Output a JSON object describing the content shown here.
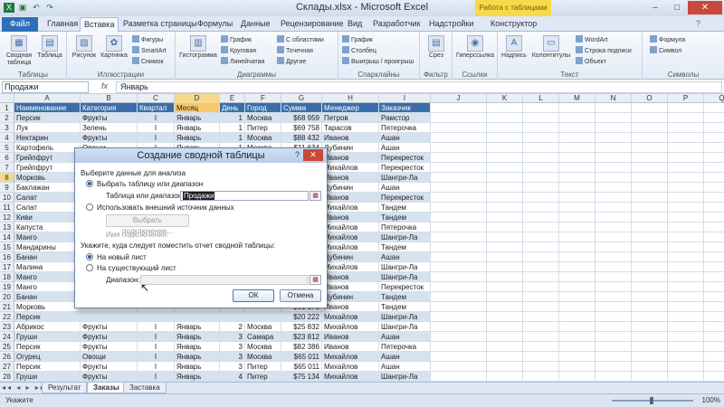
{
  "window": {
    "title": "Склады.xlsx - Microsoft Excel",
    "context_tab_group": "Работа с таблицами",
    "controls": {
      "min": "–",
      "max": "□",
      "close": "✕"
    }
  },
  "ribbon_tabs": [
    "Файл",
    "Главная",
    "Вставка",
    "Разметка страницы",
    "Формулы",
    "Данные",
    "Рецензирование",
    "Вид",
    "Разработчик",
    "Надстройки",
    "Конструктор"
  ],
  "ribbon": {
    "groups": [
      "Таблицы",
      "Иллюстрации",
      "Диаграммы",
      "Спарклайны",
      "Фильтр",
      "Ссылки",
      "Текст",
      "Символы"
    ],
    "buttons": {
      "pivot": "Сводная таблица",
      "table": "Таблица",
      "picture": "Рисунок",
      "clipart": "Картинка",
      "shapes": "Фигуры",
      "smartart": "SmartArt",
      "screenshot": "Снимок",
      "histogram": "Гистограмма",
      "graph": "График",
      "pie": "Круговая",
      "linear": "Линейчатая",
      "area": "С областями",
      "scatter": "Точечная",
      "other": "Другие",
      "spark_line": "График",
      "spark_col": "Столбец",
      "spark_wl": "Выигрыш / проигрыш",
      "slicer": "Срез",
      "hyperlink": "Гиперссылка",
      "textbox": "Надпись",
      "header_footer": "Колонтитулы",
      "wordart": "WordArt",
      "signature": "Строка подписи",
      "object": "Объект",
      "formula": "Формула",
      "symbol": "Символ"
    }
  },
  "formula_bar": {
    "name_box": "Продажи",
    "fx": "fx",
    "value": "Январь"
  },
  "columns": [
    "A",
    "B",
    "C",
    "D",
    "E",
    "F",
    "G",
    "H",
    "I",
    "J",
    "K",
    "L",
    "M",
    "N",
    "O",
    "P",
    "Q"
  ],
  "table_headers": [
    "Наименование",
    "Категория",
    "Квартал",
    "Месяц",
    "День",
    "Город",
    "Сумма",
    "Менеджер",
    "Заказчик"
  ],
  "rows": [
    [
      "Персик",
      "Фрукты",
      "I",
      "Январь",
      "1",
      "Москва",
      "$68 959",
      "Петров",
      "Рамстор"
    ],
    [
      "Лук",
      "Зелень",
      "I",
      "Январь",
      "1",
      "Питер",
      "$69 758",
      "Тарасов",
      "Пятерочка"
    ],
    [
      "Нектарин",
      "Фрукты",
      "I",
      "Январь",
      "1",
      "Москва",
      "$88 432",
      "Иванов",
      "Ашан"
    ],
    [
      "Картофель",
      "Овощи",
      "I",
      "Январь",
      "1",
      "Москва",
      "$11 634",
      "Дубинин",
      "Ашан"
    ],
    [
      "Грейпфрут",
      "",
      "",
      "",
      "",
      "",
      "$18 298",
      "Иванов",
      "Перекресток"
    ],
    [
      "Грейпфрут",
      "",
      "",
      "",
      "",
      "",
      "$ 6 256",
      "Михайлов",
      "Перекресток"
    ],
    [
      "Морковь",
      "",
      "",
      "",
      "",
      "",
      "$ 6 634",
      "Иванов",
      "Шангри-Ла"
    ],
    [
      "Баклажан",
      "",
      "",
      "",
      "",
      "",
      "$12 548",
      "Дубинин",
      "Ашан"
    ],
    [
      "Салат",
      "",
      "",
      "",
      "",
      "",
      "$ 4 633",
      "Иванов",
      "Перекресток"
    ],
    [
      "Салат",
      "",
      "",
      "",
      "",
      "",
      "$ 8 117",
      "Михайлов",
      "Тандем"
    ],
    [
      "Киви",
      "",
      "",
      "",
      "",
      "",
      "$88 261",
      "Иванов",
      "Тандем"
    ],
    [
      "Капуста",
      "",
      "",
      "",
      "",
      "",
      "$53 162",
      "Михайлов",
      "Пятерочка"
    ],
    [
      "Манго",
      "",
      "",
      "",
      "",
      "",
      "$38 160",
      "Михайлов",
      "Шангри-Ла"
    ],
    [
      "Мандарины",
      "",
      "",
      "",
      "",
      "",
      "$15 455",
      "Михайлов",
      "Тандем"
    ],
    [
      "Банан",
      "",
      "",
      "",
      "",
      "",
      "$20 116",
      "Дубинин",
      "Ашан"
    ],
    [
      "Малина",
      "",
      "",
      "",
      "",
      "",
      "$14 264",
      "Михайлов",
      "Шангри-Ла"
    ],
    [
      "Манго",
      "",
      "",
      "",
      "",
      "",
      "$58 253",
      "Иванов",
      "Шангри-Ла"
    ],
    [
      "Манго",
      "",
      "",
      "",
      "",
      "",
      "$67 215",
      "Иванов",
      "Перекресток"
    ],
    [
      "Банан",
      "",
      "",
      "",
      "",
      "",
      "$70 633",
      "Дубинин",
      "Тандем"
    ],
    [
      "Морковь",
      "",
      "",
      "",
      "",
      "",
      "$61 171",
      "Иванов",
      "Тандем"
    ],
    [
      "Персик",
      "",
      "",
      "",
      "",
      "",
      "$20 222",
      "Михайлов",
      "Шангри-Ла"
    ],
    [
      "Абрикос",
      "Фрукты",
      "I",
      "Январь",
      "2",
      "Москва",
      "$25 832",
      "Михайлов",
      "Шангри-Ла"
    ],
    [
      "Груши",
      "Фрукты",
      "I",
      "Январь",
      "3",
      "Самара",
      "$23 812",
      "Иванов",
      "Ашан"
    ],
    [
      "Персик",
      "Фрукты",
      "I",
      "Январь",
      "3",
      "Москва",
      "$82 386",
      "Иванов",
      "Пятерочка"
    ],
    [
      "Огурец",
      "Овощи",
      "I",
      "Январь",
      "3",
      "Москва",
      "$65 011",
      "Михайлов",
      "Ашан"
    ],
    [
      "Персик",
      "Фрукты",
      "I",
      "Январь",
      "3",
      "Питер",
      "$65 011",
      "Михайлов",
      "Ашан"
    ],
    [
      "Груши",
      "Фрукты",
      "I",
      "Январь",
      "4",
      "Питер",
      "$75 134",
      "Михайлов",
      "Шангри-Ла"
    ],
    [
      "Морковь",
      "Овощи",
      "I",
      "Январь",
      "4",
      "Москва",
      "$29 231",
      "Иванов",
      "Рамстор"
    ],
    [
      "Морковь",
      "Овощи",
      "I",
      "Январь",
      "4",
      "Москва",
      "$83 315",
      "Иванов",
      "Перекресток"
    ]
  ],
  "sheets": [
    "Результат",
    "Заказы",
    "Заставка"
  ],
  "status": {
    "mode": "Укажите",
    "zoom": "100%"
  },
  "dialog": {
    "title": "Создание сводной таблицы",
    "help": "?",
    "close": "✕",
    "section1": "Выберите данные для анализа",
    "opt_range": "Выбрать таблицу или диапазон",
    "range_label": "Таблица или диапазон:",
    "range_value": "Продажи",
    "opt_external": "Использовать внешний источник данных",
    "choose_conn": "Выбрать подключение...",
    "conn_name": "Имя подключения:",
    "section2": "Укажите, куда следует поместить отчет сводной таблицы:",
    "opt_new": "На новый лист",
    "opt_existing": "На существующий лист",
    "location_label": "Диапазон:",
    "ok": "ОК",
    "cancel": "Отмена"
  }
}
